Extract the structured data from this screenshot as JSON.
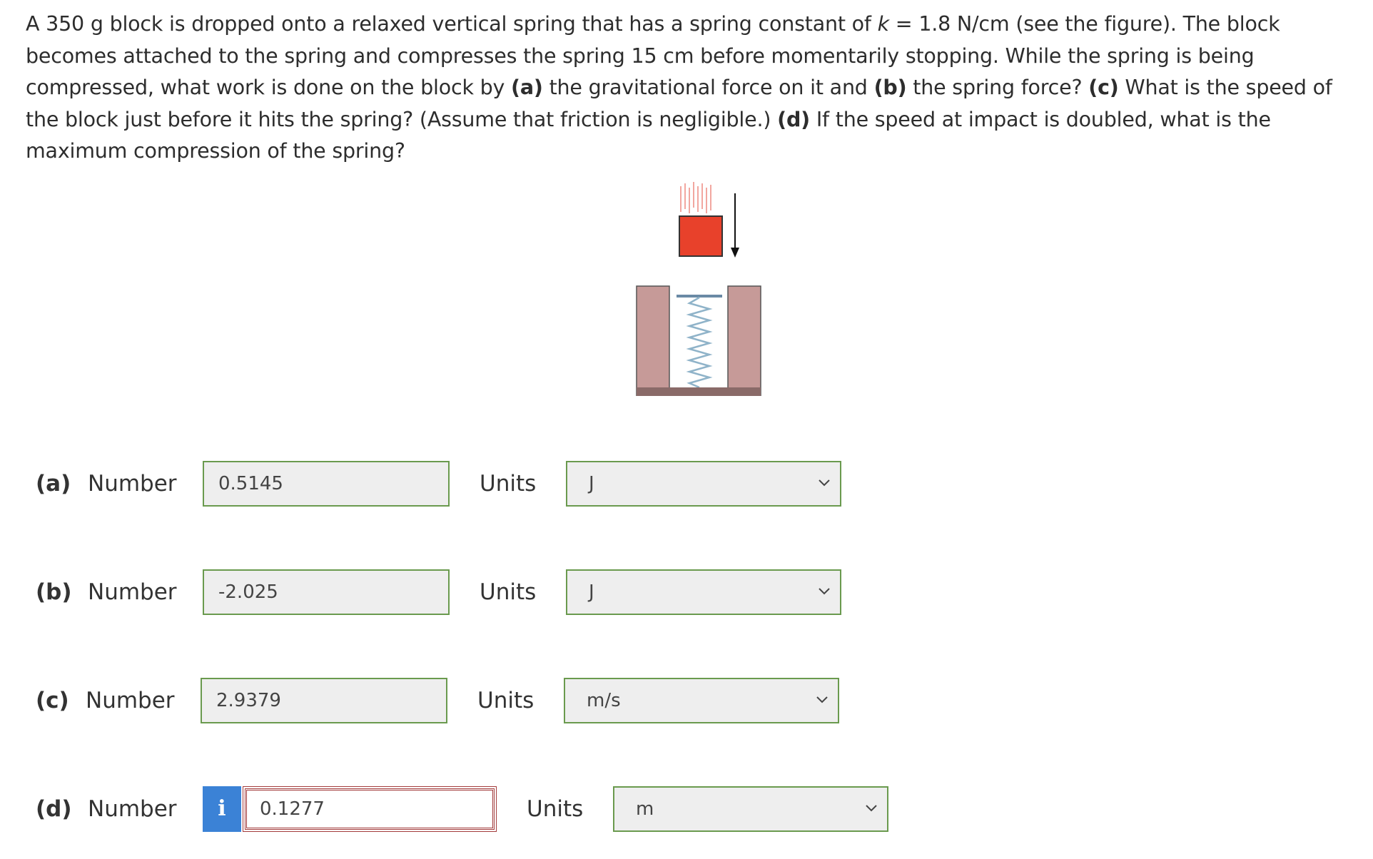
{
  "question": {
    "part1": "A 350 g block is dropped onto a relaxed vertical spring that has a spring constant of ",
    "k_symbol": "k",
    "part2": " = 1.8 N/cm (see the figure). The block becomes attached to the spring and compresses the spring 15 cm before momentarily stopping. While the spring is being compressed, what work is done on the block by ",
    "a_tag": "(a)",
    "part3": " the gravitational force on it and ",
    "b_tag": "(b)",
    "part4": " the spring force? ",
    "c_tag": "(c)",
    "part5": " What is the speed of the block just before it hits the spring? (Assume that friction is negligible.) ",
    "d_tag": "(d)",
    "part6": " If the speed at impact is doubled, what is the maximum compression of the spring?"
  },
  "rows": [
    {
      "label": "(a)",
      "number_label": "Number",
      "value": "0.5145",
      "units_label": "Units",
      "unit": "J"
    },
    {
      "label": "(b)",
      "number_label": "Number",
      "value": "-2.025",
      "units_label": "Units",
      "unit": "J"
    },
    {
      "label": "(c)",
      "number_label": "Number",
      "value": "2.9379",
      "units_label": "Units",
      "unit": "m/s"
    },
    {
      "label": "(d)",
      "number_label": "Number",
      "value": "0.1277",
      "units_label": "Units",
      "unit": "m",
      "info_icon_text": "i"
    }
  ],
  "colors": {
    "correct_border": "#6a9a4e",
    "incorrect_border": "#a33c3c",
    "info_blue": "#3b82d6",
    "block_red": "#e8412b",
    "wall_pink": "#c69a98"
  }
}
